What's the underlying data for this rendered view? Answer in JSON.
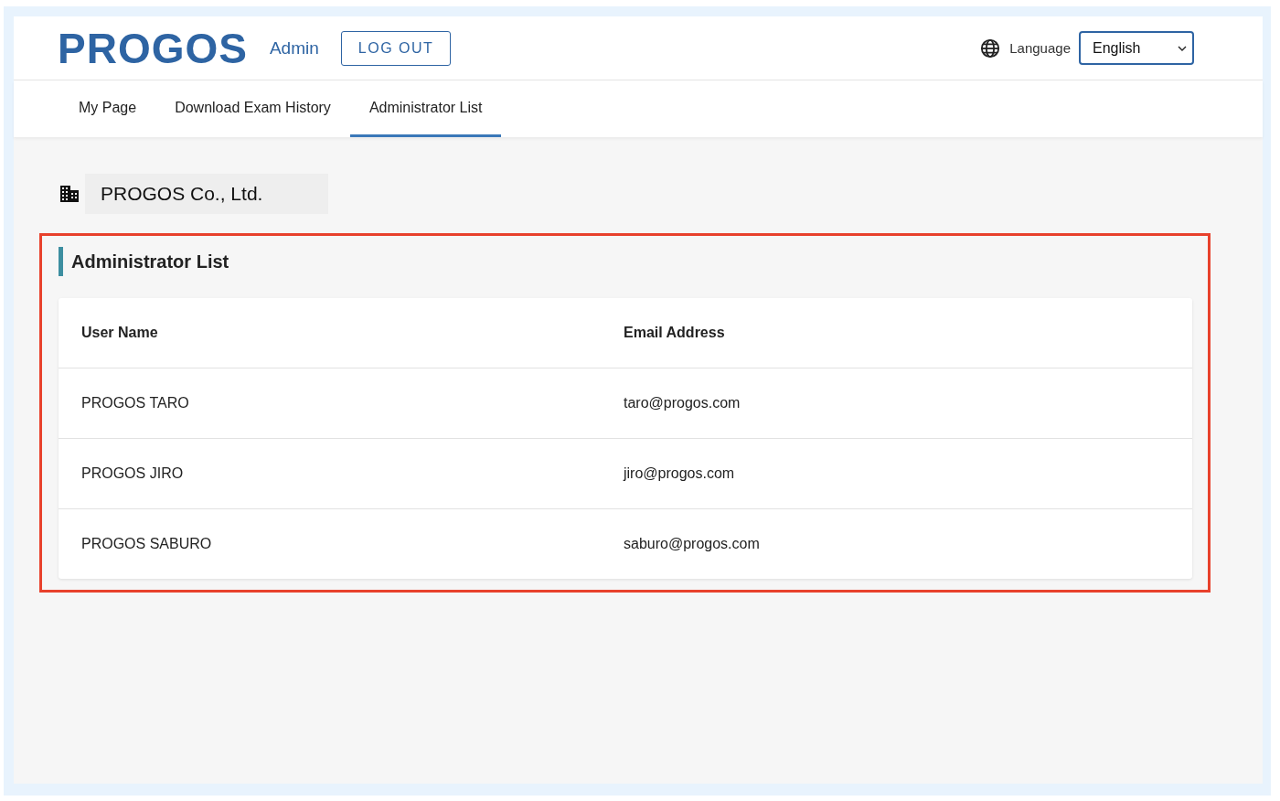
{
  "header": {
    "logo": "PROGOS",
    "role": "Admin",
    "logout": "LOG OUT",
    "language_label": "Language",
    "language_value": "English"
  },
  "nav": [
    {
      "label": "My Page",
      "selected": false
    },
    {
      "label": "Download Exam History",
      "selected": false
    },
    {
      "label": "Administrator List",
      "selected": true
    }
  ],
  "company": "PROGOS Co., Ltd.",
  "section": {
    "title": "Administrator List",
    "highlighted": true,
    "columns": [
      "User Name",
      "Email Address"
    ],
    "rows": [
      [
        "PROGOS TARO",
        "taro@progos.com"
      ],
      [
        "PROGOS JIRO",
        "jiro@progos.com"
      ],
      [
        "PROGOS SABURO",
        "saburo@progos.com"
      ]
    ]
  }
}
